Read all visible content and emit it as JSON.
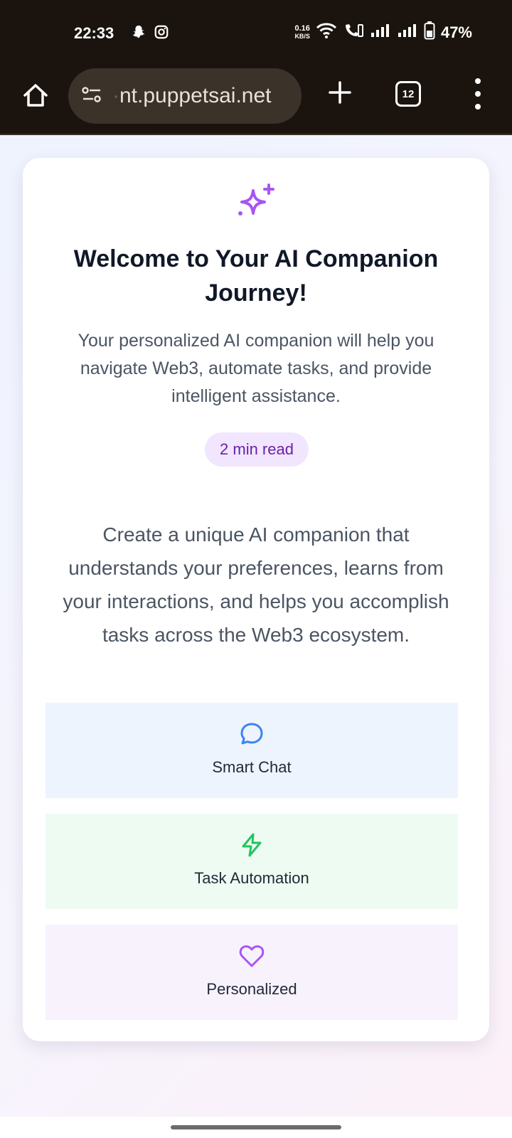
{
  "status_bar": {
    "time": "22:33",
    "net_speed_value": "0.16",
    "net_speed_unit": "KB/S",
    "battery": "47%",
    "icons": [
      "snapchat-icon",
      "instagram-icon",
      "wifi-icon",
      "wifi-call-icon",
      "signal-icon",
      "signal-icon",
      "battery-icon"
    ]
  },
  "browser": {
    "url_faded": "·",
    "url": "nt.puppetsai.net",
    "tab_count": "12"
  },
  "main": {
    "title": "Welcome to Your AI Companion Journey!",
    "subtitle": "Your personalized AI companion will help you navigate Web3, automate tasks, and provide intelligent assistance.",
    "badge": "2 min read",
    "description": "Create a unique AI companion that understands your preferences, learns from your interactions, and helps you accomplish tasks across the Web3 ecosystem.",
    "features": [
      {
        "label": "Smart Chat",
        "icon": "chat-bubble-icon",
        "color": "#3b82f6"
      },
      {
        "label": "Task Automation",
        "icon": "lightning-icon",
        "color": "#22c55e"
      },
      {
        "label": "Personalized",
        "icon": "heart-icon",
        "color": "#a855f7"
      }
    ]
  },
  "colors": {
    "accent_purple": "#a855f7",
    "title": "#101828",
    "body_text": "#4b5563",
    "browser_chrome": "#1b140e"
  }
}
